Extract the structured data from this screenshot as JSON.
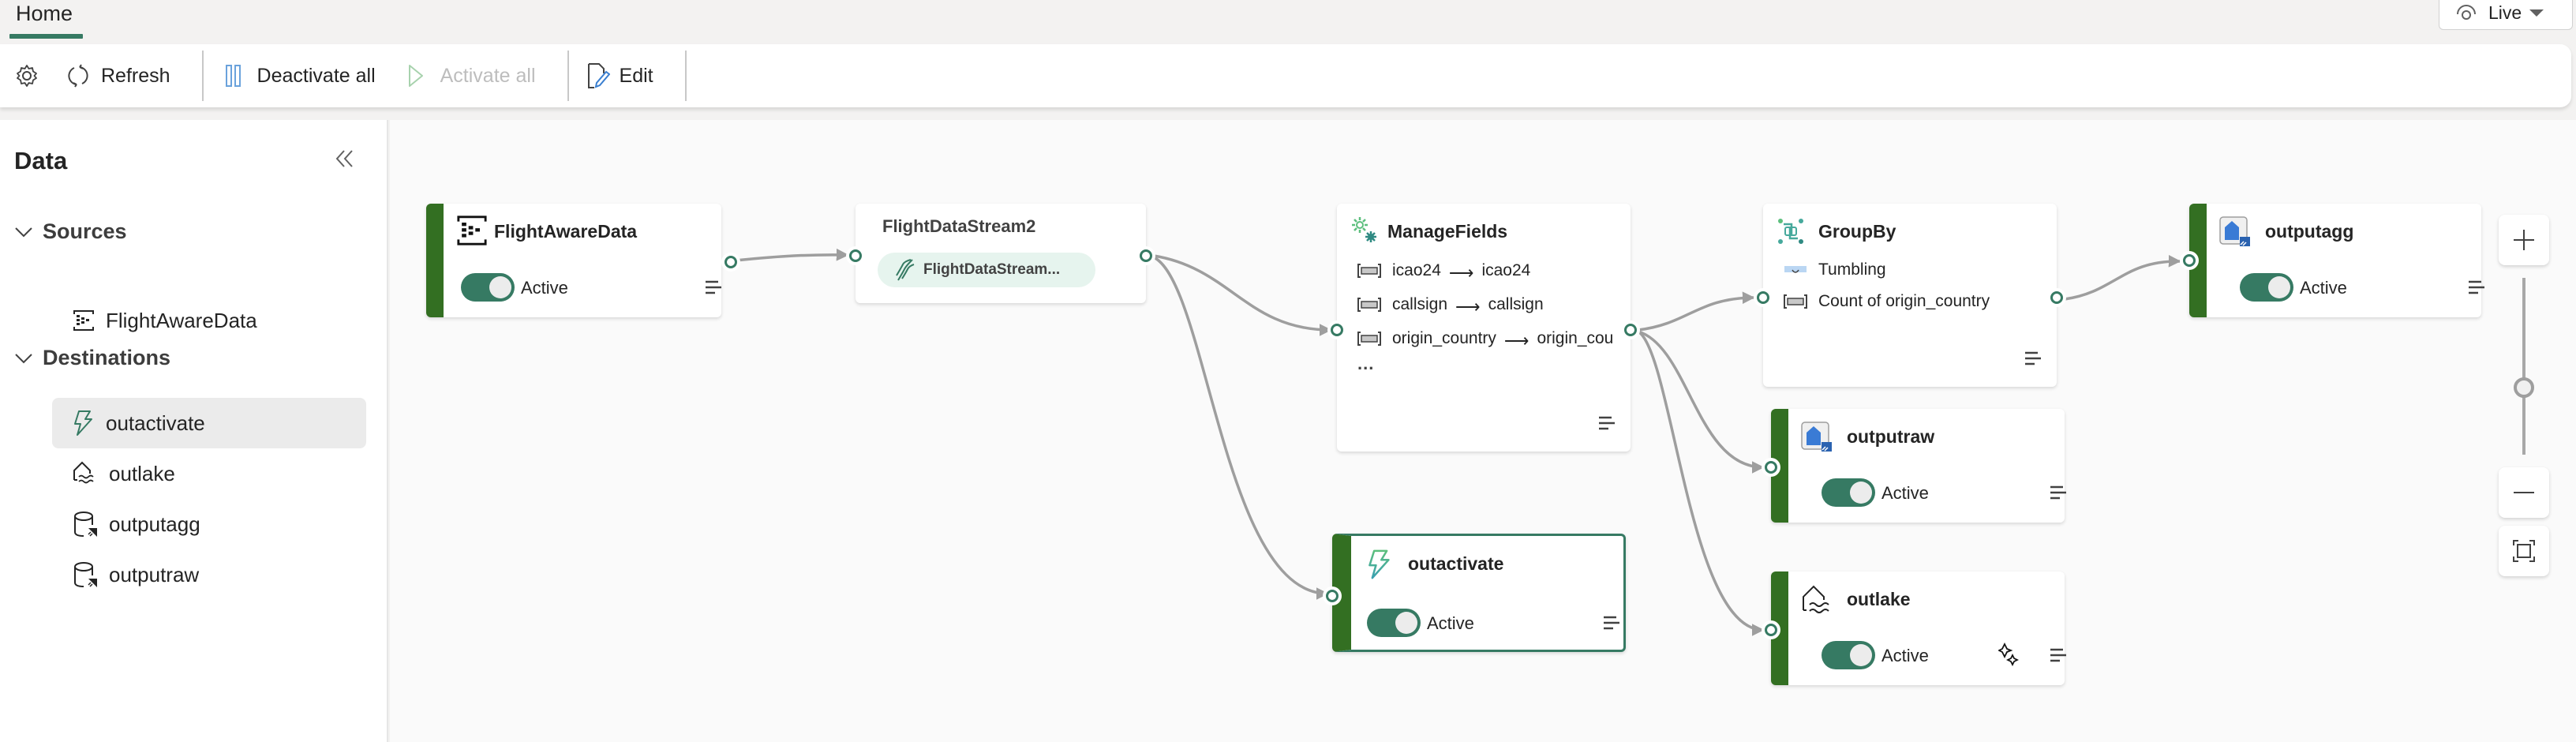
{
  "tabs": {
    "home": "Home"
  },
  "view_mode": {
    "label": "Live",
    "icon": "eye-icon"
  },
  "toolbar": {
    "settings_icon": "gear-icon",
    "refresh": "Refresh",
    "deactivate_all": "Deactivate all",
    "activate_all": "Activate all",
    "edit": "Edit"
  },
  "sidebar": {
    "title": "Data",
    "sections": [
      {
        "label": "Sources",
        "expanded": true,
        "items": [
          {
            "label": "FlightAwareData",
            "icon": "custom-source-icon"
          }
        ]
      },
      {
        "label": "Destinations",
        "expanded": true,
        "items": [
          {
            "label": "outactivate",
            "icon": "activator-icon",
            "selected": true
          },
          {
            "label": "outlake",
            "icon": "lakehouse-icon"
          },
          {
            "label": "outputagg",
            "icon": "kql-database-icon"
          },
          {
            "label": "outputraw",
            "icon": "kql-database-icon"
          }
        ]
      }
    ]
  },
  "canvas": {
    "nodes": {
      "source": {
        "title": "FlightAwareData",
        "status": "Active",
        "active": true
      },
      "stream": {
        "title": "FlightDataStream2",
        "pill": "FlightDataStream..."
      },
      "manage_fields": {
        "title": "ManageFields",
        "fields": [
          {
            "from": "icao24",
            "to": "icao24"
          },
          {
            "from": "callsign",
            "to": "callsign"
          },
          {
            "from": "origin_country",
            "to": "origin_cou"
          }
        ],
        "more": "..."
      },
      "group_by": {
        "title": "GroupBy",
        "window": "Tumbling",
        "aggregate": "Count of origin_country"
      },
      "outputagg": {
        "title": "outputagg",
        "status": "Active",
        "active": true
      },
      "outputraw": {
        "title": "outputraw",
        "status": "Active",
        "active": true
      },
      "outlake": {
        "title": "outlake",
        "status": "Active",
        "active": true
      },
      "outactivate": {
        "title": "outactivate",
        "status": "Active",
        "active": true,
        "selected": true
      }
    },
    "edges": [
      [
        "FlightAwareData",
        "FlightDataStream2"
      ],
      [
        "FlightDataStream2",
        "ManageFields"
      ],
      [
        "FlightDataStream2",
        "outactivate"
      ],
      [
        "ManageFields",
        "GroupBy"
      ],
      [
        "ManageFields",
        "outputraw"
      ],
      [
        "ManageFields",
        "outlake"
      ],
      [
        "GroupBy",
        "outputagg"
      ]
    ],
    "zoom_level": 0.5
  },
  "colors": {
    "accent": "#367a63",
    "active_bar": "#336f22",
    "edge": "#9e9e9e"
  }
}
